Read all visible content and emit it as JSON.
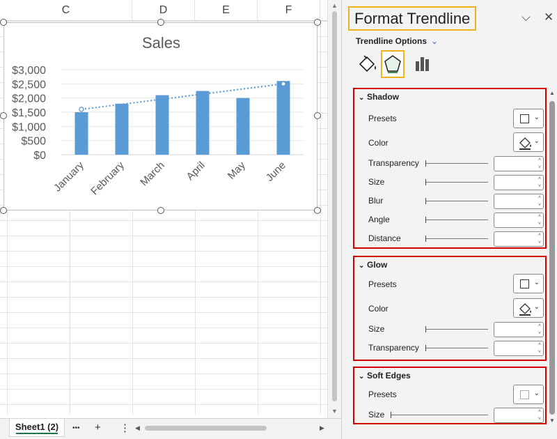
{
  "sheet": {
    "columns": [
      "C",
      "D",
      "E",
      "F"
    ],
    "tab_label": "Sheet1 (2)",
    "more_label": "•••",
    "add_label": "+",
    "menu_label": "⋮"
  },
  "chart_data": {
    "type": "bar",
    "title": "Sales",
    "categories": [
      "January",
      "February",
      "March",
      "April",
      "May",
      "June"
    ],
    "values": [
      1500,
      1800,
      2100,
      2250,
      2000,
      2600
    ],
    "yticks": [
      "$0",
      "$500",
      "$1,000",
      "$1,500",
      "$2,000",
      "$2,500",
      "$3,000"
    ],
    "ylim": [
      0,
      3000
    ],
    "bar_color": "#5b9bd5",
    "trendline": {
      "type": "linear",
      "style": "dotted",
      "start": 1600,
      "end": 2500
    },
    "grid": true
  },
  "pane": {
    "title": "Format Trendline",
    "options_label": "Trendline Options",
    "sections": {
      "shadow": {
        "title": "Shadow",
        "presets": "Presets",
        "color": "Color",
        "transparency": "Transparency",
        "size": "Size",
        "blur": "Blur",
        "angle": "Angle",
        "distance": "Distance"
      },
      "glow": {
        "title": "Glow",
        "presets": "Presets",
        "color": "Color",
        "size": "Size",
        "transparency": "Transparency"
      },
      "soft_edges": {
        "title": "Soft Edges",
        "presets": "Presets",
        "size": "Size"
      }
    },
    "accent_highlight": "#f0b020",
    "section_border": "#d40000"
  }
}
